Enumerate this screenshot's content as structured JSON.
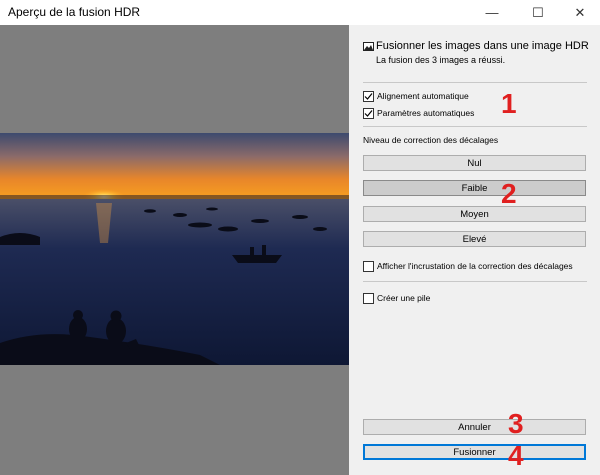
{
  "window": {
    "title": "Aperçu de la fusion HDR",
    "minimize_glyph": "—",
    "maximize_glyph": "☐",
    "close_glyph": "✕"
  },
  "panel": {
    "heading": "Fusionner les images dans une image HDR",
    "status": "La fusion des 3 images a réussi.",
    "auto_align": {
      "label": "Alignement automatique",
      "checked": true
    },
    "auto_params": {
      "label": "Paramètres automatiques",
      "checked": true
    },
    "deghost_label": "Niveau de correction des décalages",
    "deghost_options": [
      {
        "label": "Nul",
        "selected": false
      },
      {
        "label": "Faible",
        "selected": true
      },
      {
        "label": "Moyen",
        "selected": false
      },
      {
        "label": "Elevé",
        "selected": false
      }
    ],
    "overlay": {
      "label": "Afficher l'incrustation de la correction des décalages",
      "checked": false
    },
    "stack": {
      "label": "Créer une pile",
      "checked": false
    },
    "cancel_label": "Annuler",
    "merge_label": "Fusionner"
  },
  "annotations": [
    "1",
    "2",
    "3",
    "4"
  ],
  "colors": {
    "preview_background": "#7e7e7e",
    "panel_background": "#f0f0f0",
    "annotation_red": "#e02020",
    "primary_border": "#0078d7"
  }
}
